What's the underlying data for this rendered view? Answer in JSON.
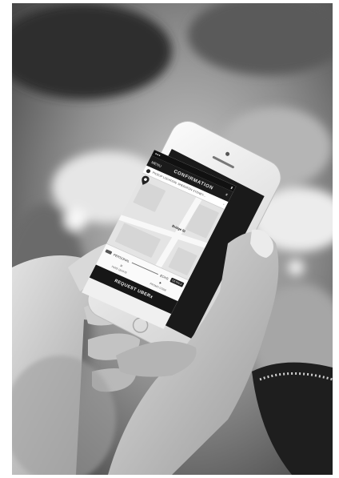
{
  "photo": {
    "subject": "hands-holding-smartphone-photo",
    "tones": {
      "background_dark": "#3a3a3a",
      "background_light": "#d8d8d8",
      "phone_body": "#f2f2f2",
      "skin": "#c9c9c9"
    }
  },
  "screen": {
    "topbar": {
      "left": "MENU",
      "title": "CONFIRMATION"
    },
    "pickup_address": "PICKUP LOCATION: SHERATON SYDNEY...",
    "map_labels": [
      "Bridge St"
    ],
    "vehicle": {
      "name": "PERSONAL",
      "eta": "ECHS",
      "detail_button": "DETAILS"
    },
    "options": [
      {
        "icon": "fare-icon",
        "label": "FARE QUOTE"
      },
      {
        "icon": "promo-icon",
        "label": "PROMO CODE"
      }
    ],
    "request_button": "REQUEST UBERx"
  }
}
